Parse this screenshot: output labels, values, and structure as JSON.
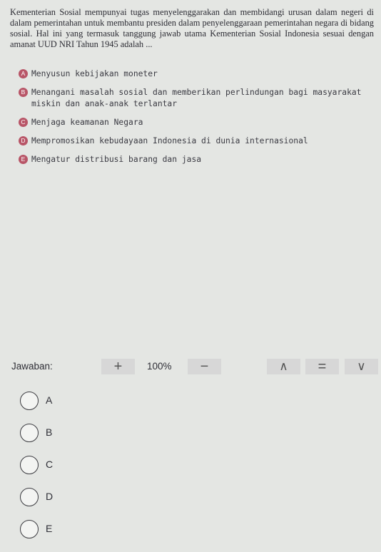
{
  "question": {
    "text": "Kementerian Sosial mempunyai tugas menyelenggarakan dan membidangi urusan dalam negeri di dalam pemerintahan untuk membantu presiden dalam penyelenggaraan pemerintahan negara di bidang sosial. Hal ini yang termasuk tanggung jawab utama Kementerian Sosial Indonesia sesuai dengan amanat UUD NRI Tahun 1945 adalah ..."
  },
  "options": [
    {
      "letter": "A",
      "text": "Menyusun kebijakan moneter"
    },
    {
      "letter": "B",
      "text": "Menangani masalah sosial dan memberikan perlindungan bagi masyarakat miskin dan anak-anak terlantar"
    },
    {
      "letter": "C",
      "text": "Menjaga keamanan Negara"
    },
    {
      "letter": "D",
      "text": "Mempromosikan kebudayaan Indonesia di dunia internasional"
    },
    {
      "letter": "E",
      "text": "Mengatur distribusi barang dan jasa"
    }
  ],
  "toolbar": {
    "answer_label": "Jawaban:",
    "zoom_in": "+",
    "zoom_level": "100%",
    "zoom_out": "−",
    "up": "∧",
    "equal": "=",
    "down": "∨"
  },
  "answers": [
    {
      "label": "A"
    },
    {
      "label": "B"
    },
    {
      "label": "C"
    },
    {
      "label": "D"
    },
    {
      "label": "E"
    }
  ],
  "colors": {
    "background": "#e4e6e3",
    "option_badge": "#b85567",
    "toolbar_button": "#d7d7d7"
  }
}
